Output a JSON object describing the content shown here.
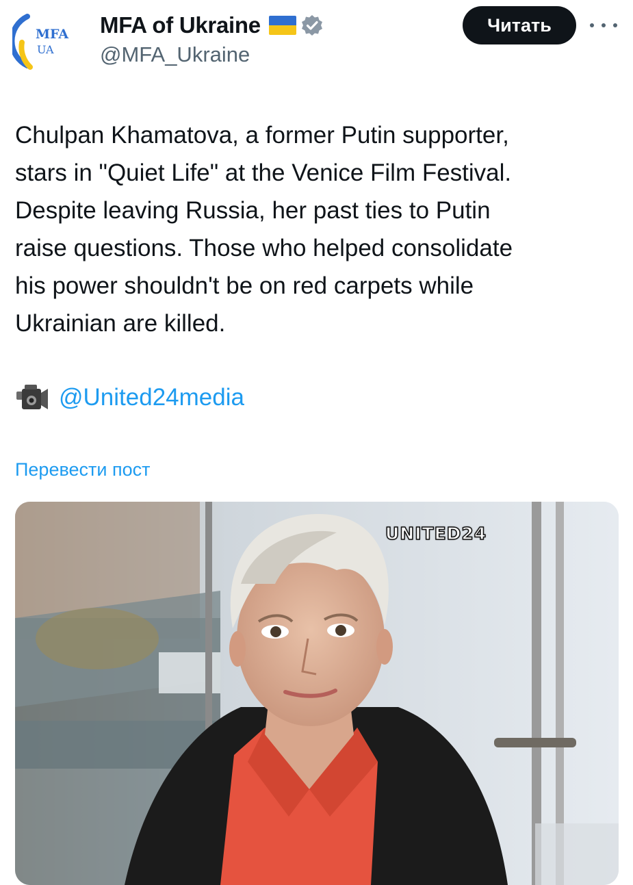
{
  "account": {
    "avatar_line1": "MFA",
    "avatar_line2": "UA",
    "name": "MFA of Ukraine",
    "handle": "@MFA_Ukraine",
    "flag_icon": "ukraine-flag-icon",
    "verified_icon": "verified-badge-icon"
  },
  "actions": {
    "follow_label": "Читать",
    "more_icon": "more-dots-icon"
  },
  "tweet": {
    "text": "Chulpan Khamatova, a former Putin supporter,\nstars in \"Quiet Life\" at the Venice Film Festival.\nDespite leaving Russia, her past ties to Putin\nraise questions. Those who helped consolidate\nhis power shouldn't be on red carpets while\nUkrainian are killed.",
    "camera_icon": "video-camera-icon",
    "mention": "@United24media",
    "translate_label": "Перевести пост"
  },
  "media": {
    "watermark": "UNITED24"
  },
  "colors": {
    "link": "#1d9bf0",
    "text": "#0f1419",
    "secondary": "#536471",
    "button_bg": "#0f1419",
    "flag_blue": "#2f6fd0",
    "flag_yellow": "#f5c518"
  }
}
